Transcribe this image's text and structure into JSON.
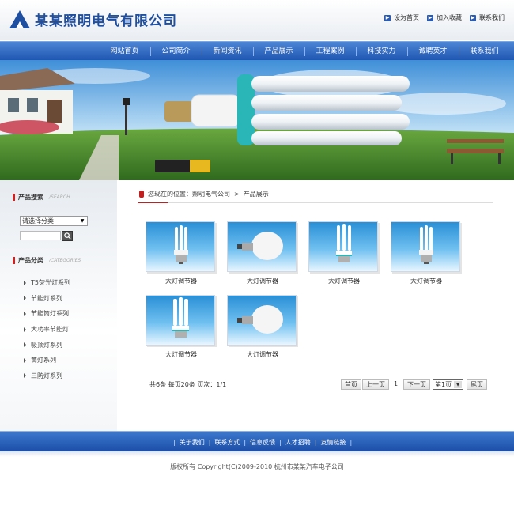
{
  "header": {
    "logo_text": "某某照明电气有限公司",
    "links": [
      {
        "label": "设为首页"
      },
      {
        "label": "加入收藏"
      },
      {
        "label": "联系我们"
      }
    ]
  },
  "nav": [
    "网站首页",
    "公司简介",
    "新闻资讯",
    "产品展示",
    "工程案例",
    "科技实力",
    "诚聘英才",
    "联系我们"
  ],
  "sidebar": {
    "search_title": "产品搜索",
    "search_title_en": "/SEARCH",
    "select_value": "请选择分类",
    "category_title": "产品分类",
    "category_title_en": "/CATEGORIES",
    "categories": [
      "T5荧光灯系列",
      "节能灯系列",
      "节能筒灯系列",
      "大功率节能灯",
      "吸顶灯系列",
      "筒灯系列",
      "三防灯系列"
    ]
  },
  "breadcrumb": {
    "label": "您现在的位置：照明电气公司",
    "separator": ">",
    "current": "产品展示"
  },
  "products": [
    {
      "caption": "大灯调节器",
      "icon": "u-lamp-icon"
    },
    {
      "caption": "大灯调节器",
      "icon": "bulb-icon"
    },
    {
      "caption": "大灯调节器",
      "icon": "u-lamp-icon"
    },
    {
      "caption": "大灯调节器",
      "icon": "u-lamp-icon"
    },
    {
      "caption": "大灯调节器",
      "icon": "u-lamp-icon"
    },
    {
      "caption": "大灯调节器",
      "icon": "bulb-icon"
    }
  ],
  "pager": {
    "info": "共6条  每页20条  页次：1/1",
    "first": "首页",
    "prev": "上一页",
    "page": "1",
    "next": "下一页",
    "select": "第1页",
    "last": "尾页"
  },
  "footer": {
    "links": [
      "关于我们",
      "联系方式",
      "信息反馈",
      "人才招聘",
      "友情链接"
    ],
    "copyright": "版权所有  Copyright(C)2009-2010 杭州市某某汽车电子公司"
  },
  "colors": {
    "brand_blue": "#1f56b2",
    "accent_red": "#c02020"
  }
}
